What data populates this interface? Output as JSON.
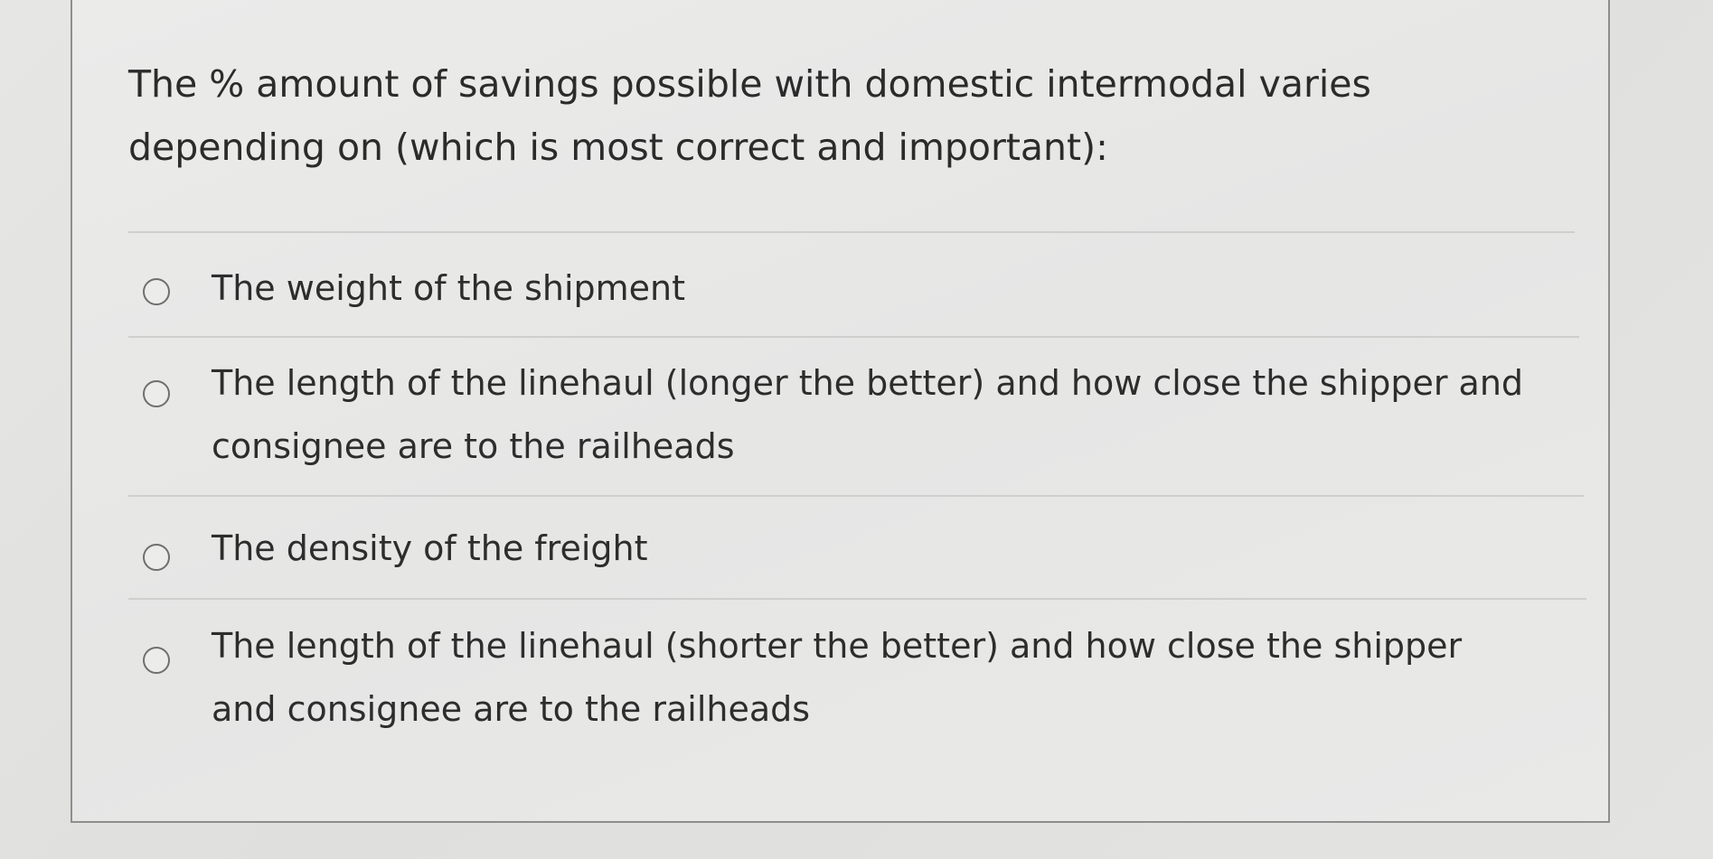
{
  "question": {
    "text": "The % amount of savings possible with domestic intermodal varies depending on (which is most correct and important):"
  },
  "options": [
    {
      "label": "The weight of the shipment",
      "selected": false
    },
    {
      "label": "The length of the linehaul (longer the better) and how close the shipper and consignee are to the railheads",
      "selected": false
    },
    {
      "label": "The density of the freight",
      "selected": false
    },
    {
      "label": "The length of the linehaul (shorter the better) and how close the shipper and consignee are to the railheads",
      "selected": false
    }
  ]
}
